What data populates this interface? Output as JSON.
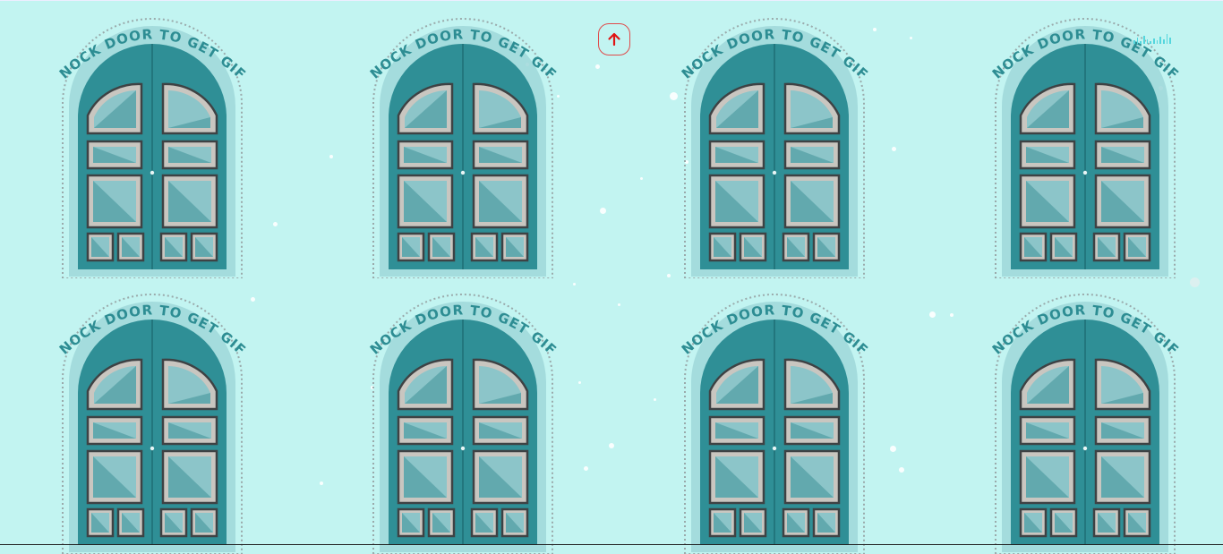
{
  "doors": [
    {
      "label": "KNOCK DOOR TO GET GIFT"
    },
    {
      "label": "KNOCK DOOR TO GET GIFT"
    },
    {
      "label": "KNOCK DOOR TO GET GIFT"
    },
    {
      "label": "KNOCK DOOR TO GET GIFT"
    },
    {
      "label": "KNOCK DOOR TO GET GIFT"
    },
    {
      "label": "KNOCK DOOR TO GET GIFT"
    },
    {
      "label": "KNOCK DOOR TO GET GIFT"
    },
    {
      "label": "KNOCK DOOR TO GET GIFT"
    }
  ],
  "icons": {
    "scroll_top": "arrow-up-icon",
    "music": "audio-bars-icon"
  },
  "colors": {
    "background": "#c2f4f1",
    "door": "#2f8f96",
    "label": "#2d8d93",
    "scroll_button": "#e04a4a",
    "music_bars": "#55d6dd"
  }
}
